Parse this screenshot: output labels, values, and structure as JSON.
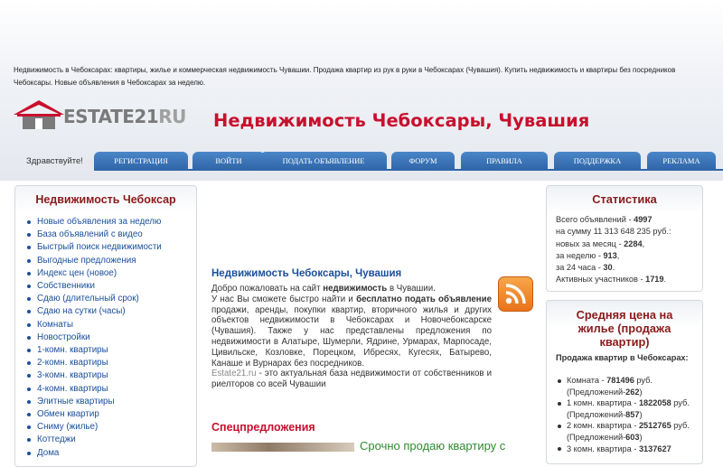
{
  "header": {
    "description": "Недвижимость в Чебоксарах: квартиры, жилье и коммерческая недвижимость Чувашии. Продажа квартир из рук в руки в Чебоксарах (Чувашия). Купить недвижимость и квартиры без посредников Чебоксары. Новые объявления в Чебоксарах за неделю.",
    "logo_main": "ESTATE21",
    "logo_suffix": "RU",
    "site_title": "Недвижимость Чебоксары, Чувашия",
    "greeting": "Здравствуйте!"
  },
  "nav": [
    "Регистрация",
    "Войти",
    "Подать объявление",
    "Форум",
    "Правила",
    "Поддержка",
    "Реклама"
  ],
  "left": {
    "title": "Недвижимость Чебоксар",
    "items": [
      "Новые объявления за неделю",
      "База объявлений с видео",
      "Быстрый поиск недвижимости",
      "Выгодные предложения",
      "Индекс цен (новое)",
      "Собственники",
      "Сдаю (длительный срок)",
      "Сдаю на сутки (часы)",
      "Комнаты",
      "Новостройки",
      "1-комн. квартиры",
      "2-комн. квартиры",
      "3-комн. квартиры",
      "4-комн. квартиры",
      "Элитные квартиры",
      "Обмен квартир",
      "Сниму (жилье)",
      "Коттеджи",
      "Дома"
    ]
  },
  "center": {
    "title": "Недвижимость Чебоксары, Чувашия",
    "p1_a": "Добро пожаловать на сайт ",
    "p1_b": "недвижимость",
    "p1_c": " в Чувашии.",
    "p2_a": "У нас Вы сможете быстро найти и ",
    "p2_b": "бесплатно подать объявление",
    "p2_c": " продажи, аренды, покупки квартир, вторичного жилья и других объектов недвижимости в Чебоксарах и Новочебоксарске (Чувашия). Также у нас представлены предложения по недвижимости в Алатыре, Шумерли, Ядрине, Урмарах, Марпосаде, Цивильске, Козловке, Порецком, Ибресях, Кугесях, Батырево, Канаше и Вурнарах без посредников.",
    "p3_a": "Estate21.ru",
    "p3_b": " - это актуальная база недвижимости от собственников и риелторов со всей Чувашии",
    "spec_title": "Спецпредложения",
    "spec_link": "Срочно продаю квартиру с"
  },
  "stats": {
    "title": "Статистика",
    "l1": "Всего объявлений - ",
    "v1": "4997",
    "l2": "на сумму 11 313 648 235 руб.:",
    "l3": "новых за месяц - ",
    "v3": "2284",
    "l4": "за неделю - ",
    "v4": "913",
    "l5": "за 24 часа - ",
    "v5": "30",
    "l6": "Активных участников - ",
    "v6": "1719"
  },
  "avg": {
    "title": "Средняя цена на жилье (продажа квартир)",
    "head": "Продажа квартир в Чебоксарах:",
    "items": [
      {
        "label": "Комната - ",
        "price": "781496",
        "offers": "262"
      },
      {
        "label": "1 комн. квартира - ",
        "price": "1822058",
        "offers": "857"
      },
      {
        "label": "2 комн. квартира - ",
        "price": "2512765",
        "offers": "603"
      },
      {
        "label": "3 комн. квартира - ",
        "price": "3137627",
        "offers": ""
      }
    ],
    "rub": " руб.",
    "offers_label": "(Предложений-"
  },
  "colors": {
    "title_red": "#c8102e",
    "link_blue": "#1a4f9c",
    "nav_blue": "#2f66a8",
    "heading_darkred": "#8b1a1a",
    "special_green": "#2e8b2e"
  }
}
